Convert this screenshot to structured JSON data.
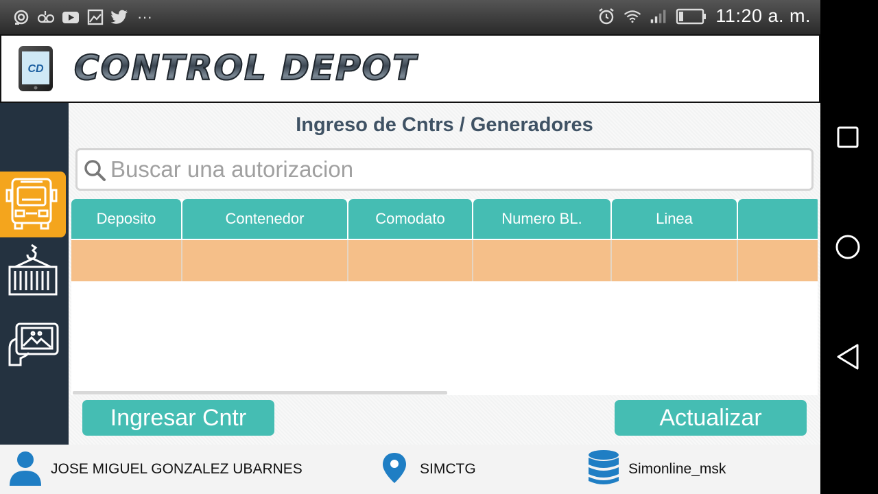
{
  "status_bar": {
    "time": "11:20 a. m.",
    "left_icons": [
      "sync-icon",
      "voicemail-icon",
      "youtube-icon",
      "image-icon",
      "twitter-icon",
      "more-icon"
    ],
    "right_icons": [
      "alarm-icon",
      "wifi-icon",
      "signal-icon",
      "battery-icon"
    ]
  },
  "header": {
    "logo_text": "CD",
    "app_name": "CONTROL DEPOT"
  },
  "sidebar": {
    "items": [
      {
        "icon": "truck-icon",
        "active": true
      },
      {
        "icon": "container-crane-icon",
        "active": false
      },
      {
        "icon": "photo-tablet-icon",
        "active": false
      }
    ]
  },
  "main": {
    "title": "Ingreso de Cntrs / Generadores",
    "search": {
      "placeholder": "Buscar una autorizacion",
      "value": ""
    },
    "table": {
      "columns": [
        "Deposito",
        "Contenedor",
        "Comodato",
        "Numero BL.",
        "Linea",
        ""
      ],
      "rows": [
        [
          "",
          "",
          "",
          "",
          "",
          ""
        ]
      ]
    },
    "buttons": {
      "ingresar": "Ingresar Cntr",
      "actualizar": "Actualizar"
    }
  },
  "footer": {
    "user": "JOSE MIGUEL GONZALEZ UBARNES",
    "location": "SIMCTG",
    "database": "Simonline_msk"
  },
  "colors": {
    "accent": "#45bdb3",
    "row_highlight": "#f5bf89",
    "sidebar_bg": "#243240",
    "sidebar_active": "#f4a51d",
    "title_text": "#3f5264"
  }
}
